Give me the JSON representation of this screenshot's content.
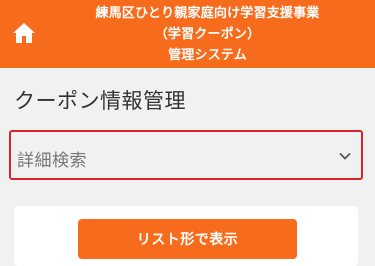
{
  "header": {
    "title_lines": [
      "練馬区ひとり親家庭向け学習支援事業",
      "（学習クーポン）",
      "管理システム"
    ],
    "background_color": "#f76c1c",
    "home_icon": "home-icon"
  },
  "page": {
    "title": "クーポン情報管理"
  },
  "search": {
    "label": "詳細検索",
    "expand_icon": "chevron-down-icon",
    "border_color": "#d6242e"
  },
  "actions": {
    "list_view_label": "リスト形で表示"
  }
}
